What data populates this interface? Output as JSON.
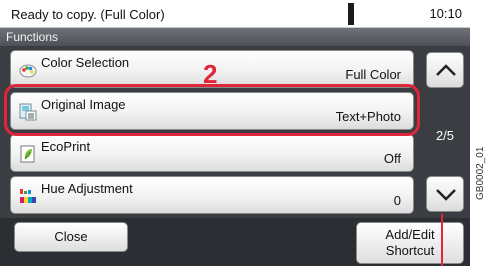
{
  "status": {
    "message": "Ready to copy. (Full Color)",
    "time": "10:10"
  },
  "title": "Functions",
  "callout_number": "2",
  "items": [
    {
      "label": "Color Selection",
      "value": "Full Color",
      "icon": "color-selection-icon"
    },
    {
      "label": "Original Image",
      "value": "Text+Photo",
      "icon": "original-image-icon"
    },
    {
      "label": "EcoPrint",
      "value": "Off",
      "icon": "ecoprint-icon"
    },
    {
      "label": "Hue Adjustment",
      "value": "0",
      "icon": "hue-adjustment-icon"
    }
  ],
  "page_indicator": "2/5",
  "buttons": {
    "close": "Close",
    "add_edit_line1": "Add/Edit",
    "add_edit_line2": "Shortcut"
  },
  "figure_code": "GB0002_01",
  "colors": {
    "highlight": "#e0263a",
    "panel": "#2b2e33",
    "titlebar": "#5a5e64"
  }
}
